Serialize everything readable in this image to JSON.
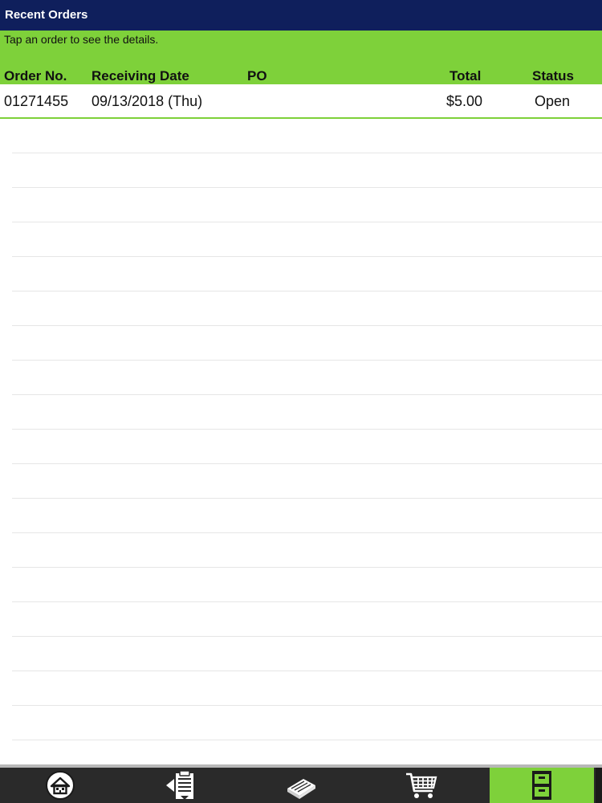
{
  "header": {
    "title": "Recent Orders"
  },
  "subheader": {
    "hint": "Tap an order to see the details."
  },
  "columns": {
    "order_no": "Order No.",
    "receiving_date": "Receiving Date",
    "po": "PO",
    "total": "Total",
    "status": "Status"
  },
  "orders": [
    {
      "order_no": "01271455",
      "receiving_date": "09/13/2018 (Thu)",
      "po": "",
      "total": "$5.00",
      "status": "Open"
    }
  ],
  "tabs": [
    {
      "icon": "home-icon",
      "active": false
    },
    {
      "icon": "clipboard-icon",
      "active": false
    },
    {
      "icon": "catalog-book-icon",
      "active": false
    },
    {
      "icon": "cart-icon",
      "active": false
    },
    {
      "icon": "file-cabinet-icon",
      "active": true
    }
  ],
  "colors": {
    "title_bar": "#0f1f5c",
    "accent_green": "#7ed13a",
    "tab_bar": "#2a2a2a"
  }
}
